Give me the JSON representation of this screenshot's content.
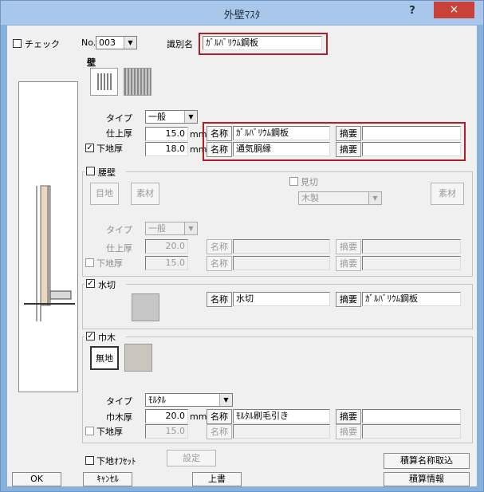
{
  "window": {
    "title": "外壁ﾏｽﾀ",
    "help_label": "?",
    "close_label": "×"
  },
  "header": {
    "check_label": "チェック",
    "check_checked": false,
    "no_label": "No.",
    "no_value": "003",
    "id_label": "識別名",
    "id_value": "ｶﾞﾙﾊﾞﾘｳﾑ鋼板"
  },
  "wall": {
    "label": "壁",
    "type_label": "タイプ",
    "type_value": "一般",
    "finish_thickness_label": "仕上厚",
    "finish_thickness_value": "15.0",
    "base_thickness_label": "下地厚",
    "base_thickness_value": "18.0",
    "base_checked": true,
    "unit": "mm",
    "name_label": "名称",
    "summary_label": "摘要",
    "finish_name": "ｶﾞﾙﾊﾞﾘｳﾑ鋼板",
    "finish_summary": "",
    "base_name": "通気胴縁",
    "base_summary": ""
  },
  "wainscot": {
    "label": "腰壁",
    "checked": false,
    "joint_button": "目地",
    "material_button": "素材",
    "mikiri_label": "見切",
    "mikiri_checked": false,
    "mikiri_select": "木製",
    "mikiri_material_button": "素材",
    "type_label": "タイプ",
    "type_value": "一般",
    "finish_thickness_label": "仕上厚",
    "finish_thickness_value": "20.0",
    "base_thickness_label": "下地厚",
    "base_thickness_value": "15.0",
    "base_checked": false,
    "name_label": "名称",
    "summary_label": "摘要",
    "finish_name": "",
    "finish_summary": "",
    "base_name": "",
    "base_summary": ""
  },
  "water_cut": {
    "label": "水切",
    "checked": true,
    "name_label": "名称",
    "name_value": "水切",
    "summary_label": "摘要",
    "summary_value": "ｶﾞﾙﾊﾞﾘｳﾑ鋼板"
  },
  "baseboard": {
    "label": "巾木",
    "checked": true,
    "plain_button": "無地",
    "type_label": "タイプ",
    "type_value": "ﾓﾙﾀﾙ",
    "thickness_label": "巾木厚",
    "thickness_value": "20.0",
    "unit": "mm",
    "base_thickness_label": "下地厚",
    "base_thickness_value": "15.0",
    "base_checked": false,
    "name_label": "名称",
    "name_value": "ﾓﾙﾀﾙ刷毛引き",
    "summary_label": "摘要",
    "summary_value": "",
    "base_name": "",
    "base_summary": ""
  },
  "footer": {
    "offset_label": "下地ｵﾌｾｯﾄ",
    "offset_checked": false,
    "settings_button": "設定",
    "estimate_import_button": "積算名称取込",
    "ok_button": "OK",
    "cancel_button": "ｷｬﾝｾﾙ",
    "overwrite_button": "上書",
    "estimate_info_button": "積算情報"
  },
  "icons": {
    "check_mark": "✓",
    "dropdown_arrow": "▼"
  },
  "colors": {
    "highlight_border": "#b01e2a",
    "title_bar": "#a9c7ea",
    "close_button": "#c9423a"
  }
}
